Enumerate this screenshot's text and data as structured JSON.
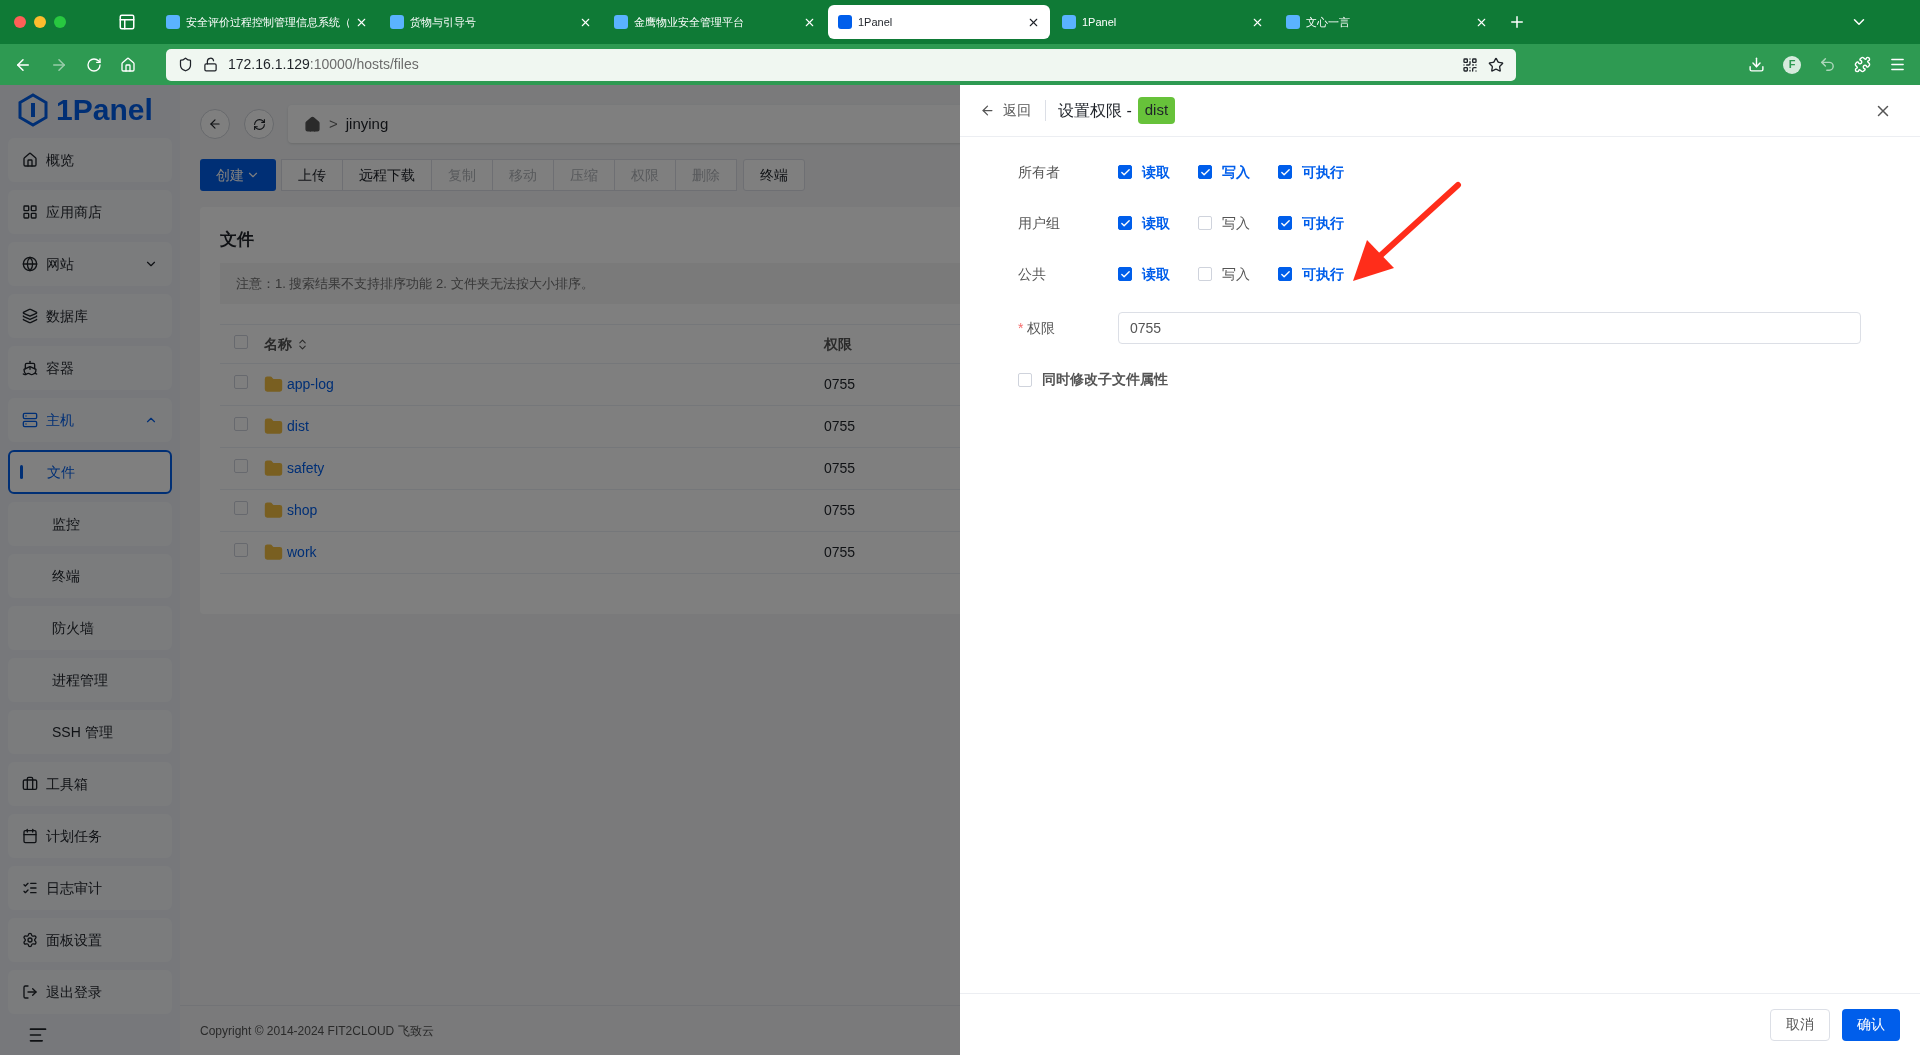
{
  "browser": {
    "tabs": [
      {
        "title": "安全评价过程控制管理信息系统（",
        "selected": false
      },
      {
        "title": "货物与引导号",
        "selected": false
      },
      {
        "title": "金鹰物业安全管理平台",
        "selected": false
      },
      {
        "title": "1Panel",
        "selected": true
      },
      {
        "title": "1Panel",
        "selected": false
      },
      {
        "title": "文心一言",
        "selected": false
      }
    ],
    "url": {
      "host": "172.16.1.129",
      "path": ":10000/hosts/files"
    },
    "profile": "F"
  },
  "sidebar": {
    "logo": "1Panel",
    "items": [
      {
        "label": "概览",
        "selected": false
      },
      {
        "label": "应用商店",
        "selected": false
      },
      {
        "label": "网站",
        "selected": false,
        "expanded": false
      },
      {
        "label": "数据库",
        "selected": false
      },
      {
        "label": "容器",
        "selected": false
      },
      {
        "label": "主机",
        "selected": false,
        "expanded": true,
        "children": [
          {
            "label": "文件",
            "selected": true
          },
          {
            "label": "监控",
            "selected": false
          },
          {
            "label": "终端",
            "selected": false
          },
          {
            "label": "防火墙",
            "selected": false
          },
          {
            "label": "进程管理",
            "selected": false
          },
          {
            "label": "SSH 管理",
            "selected": false
          }
        ]
      },
      {
        "label": "工具箱",
        "selected": false
      },
      {
        "label": "计划任务",
        "selected": false
      },
      {
        "label": "日志审计",
        "selected": false
      },
      {
        "label": "面板设置",
        "selected": false
      },
      {
        "label": "退出登录",
        "selected": false
      }
    ]
  },
  "main": {
    "breadcrumb_separator": ">",
    "breadcrumb": [
      "jinying"
    ],
    "all_checked": false,
    "toolbar": [
      {
        "label": "创建",
        "kind": "primary",
        "disabled": false
      },
      {
        "label": "上传",
        "kind": "group",
        "disabled": false
      },
      {
        "label": "远程下载",
        "kind": "group",
        "disabled": false
      },
      {
        "label": "复制",
        "kind": "group",
        "disabled": true
      },
      {
        "label": "移动",
        "kind": "group",
        "disabled": true
      },
      {
        "label": "压缩",
        "kind": "group",
        "disabled": true
      },
      {
        "label": "权限",
        "kind": "group",
        "disabled": true
      },
      {
        "label": "删除",
        "kind": "group",
        "disabled": true
      },
      {
        "label": "终端",
        "kind": "single",
        "disabled": false
      }
    ],
    "title": "文件",
    "notice": "注意：1. 搜索结果不支持排序功能 2. 文件夹无法按大小排序。",
    "columns": [
      "名称",
      "权限"
    ],
    "rows": [
      {
        "name": "app-log",
        "permission": "0755",
        "checked": false
      },
      {
        "name": "dist",
        "permission": "0755",
        "checked": false
      },
      {
        "name": "safety",
        "permission": "0755",
        "checked": false
      },
      {
        "name": "shop",
        "permission": "0755",
        "checked": false
      },
      {
        "name": "work",
        "permission": "0755",
        "checked": false
      }
    ],
    "copyright": "Copyright © 2014-2024 FIT2CLOUD 飞致云"
  },
  "drawer": {
    "back": "返回",
    "title": "设置权限 -",
    "tag": "dist",
    "rows": [
      {
        "label": "所有者",
        "perms": [
          {
            "label": "读取",
            "checked": true
          },
          {
            "label": "写入",
            "checked": true
          },
          {
            "label": "可执行",
            "checked": true
          }
        ]
      },
      {
        "label": "用户组",
        "perms": [
          {
            "label": "读取",
            "checked": true
          },
          {
            "label": "写入",
            "checked": false
          },
          {
            "label": "可执行",
            "checked": true
          }
        ]
      },
      {
        "label": "公共",
        "perms": [
          {
            "label": "读取",
            "checked": true
          },
          {
            "label": "写入",
            "checked": false
          },
          {
            "label": "可执行",
            "checked": true
          }
        ]
      }
    ],
    "field": {
      "label": "权限",
      "required_mark": "*",
      "value": "0755"
    },
    "sub": {
      "label": "同时修改子文件属性",
      "checked": false
    },
    "buttons": [
      {
        "label": "取消",
        "kind": "default"
      },
      {
        "label": "确认",
        "kind": "primary"
      }
    ]
  }
}
